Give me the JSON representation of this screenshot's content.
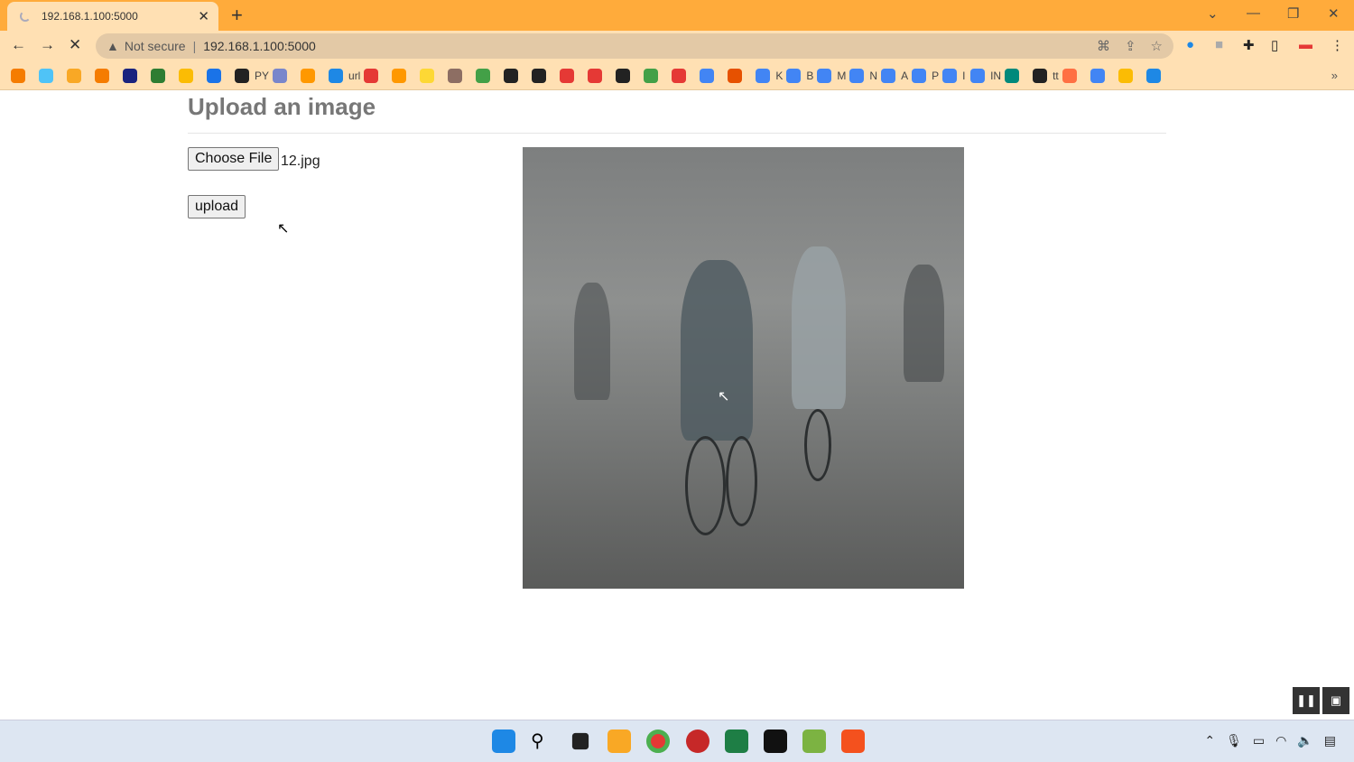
{
  "browser": {
    "tab_title": "192.168.1.100:5000",
    "security_label": "Not secure",
    "url": "192.168.1.100:5000",
    "bookmarks": [
      {
        "label": "",
        "color": "#f57c00"
      },
      {
        "label": "",
        "color": "#4fc3f7"
      },
      {
        "label": "",
        "color": "#f9a825"
      },
      {
        "label": "",
        "color": "#f57c00"
      },
      {
        "label": "",
        "color": "#1a237e"
      },
      {
        "label": "",
        "color": "#2e7d32"
      },
      {
        "label": "",
        "color": "#fbbc04"
      },
      {
        "label": "",
        "color": "#1a73e8"
      },
      {
        "label": "PY",
        "color": "#222"
      },
      {
        "label": "",
        "color": "#7986cb"
      },
      {
        "label": "",
        "color": "#ff9800"
      },
      {
        "label": "url",
        "color": "#1e88e5"
      },
      {
        "label": "",
        "color": "#e53935"
      },
      {
        "label": "",
        "color": "#ff9800"
      },
      {
        "label": "",
        "color": "#fdd835"
      },
      {
        "label": "",
        "color": "#8d6e63"
      },
      {
        "label": "",
        "color": "#43a047"
      },
      {
        "label": "",
        "color": "#222"
      },
      {
        "label": "",
        "color": "#222"
      },
      {
        "label": "",
        "color": "#e53935"
      },
      {
        "label": "",
        "color": "#e53935"
      },
      {
        "label": "",
        "color": "#222"
      },
      {
        "label": "",
        "color": "#43a047"
      },
      {
        "label": "",
        "color": "#e53935"
      },
      {
        "label": "",
        "color": "#4285f4"
      },
      {
        "label": "",
        "color": "#e65100"
      },
      {
        "label": "K",
        "color": "#4285f4"
      },
      {
        "label": "B",
        "color": "#4285f4"
      },
      {
        "label": "M",
        "color": "#4285f4"
      },
      {
        "label": "N",
        "color": "#4285f4"
      },
      {
        "label": "A",
        "color": "#4285f4"
      },
      {
        "label": "P",
        "color": "#4285f4"
      },
      {
        "label": "I",
        "color": "#4285f4"
      },
      {
        "label": "IN",
        "color": "#4285f4"
      },
      {
        "label": "",
        "color": "#00897b"
      },
      {
        "label": "tt",
        "color": "#222"
      },
      {
        "label": "",
        "color": "#ff7043"
      },
      {
        "label": "",
        "color": "#4285f4"
      },
      {
        "label": "",
        "color": "#fbbc04"
      },
      {
        "label": "",
        "color": "#1e88e5"
      }
    ]
  },
  "page": {
    "heading": "Upload an image",
    "choose_file_label": "Choose File",
    "file_name": "12.jpg",
    "upload_label": "upload"
  }
}
